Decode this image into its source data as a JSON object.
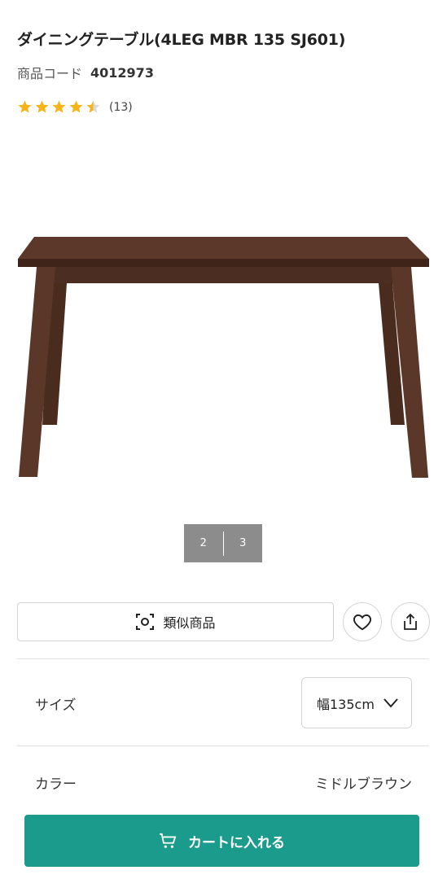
{
  "product": {
    "title": "ダイニングテーブル(4LEG MBR 135 SJ601)",
    "code_label": "商品コード",
    "code_value": "4012973",
    "rating": 4.5,
    "rating_count": "(13)",
    "star_color": "#f5b417"
  },
  "gallery": {
    "page_2": "2",
    "page_3": "3"
  },
  "actions": {
    "similar_label": "類似商品",
    "favorite_icon": "heart-icon",
    "share_icon": "share-icon"
  },
  "options": {
    "size_label": "サイズ",
    "size_value": "幅135cm",
    "color_label": "カラー",
    "color_value": "ミドルブラウン"
  },
  "cart": {
    "label": "カートに入れる",
    "color": "#1a9b8b"
  }
}
